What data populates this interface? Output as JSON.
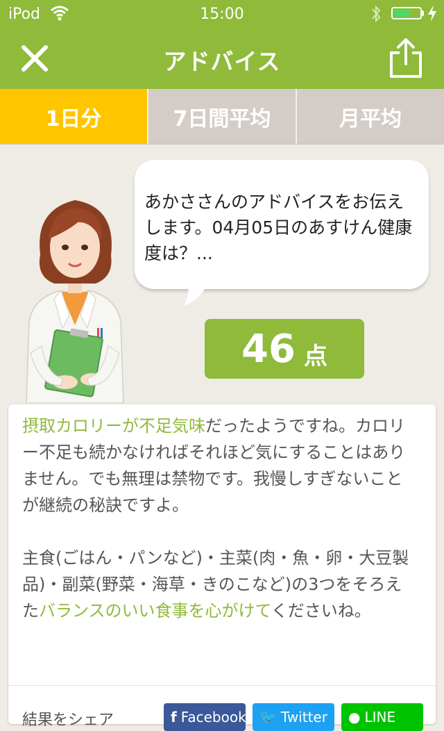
{
  "status_bar": {
    "carrier": "iPod",
    "time": "15:00",
    "battery_level": 0.65
  },
  "nav": {
    "title": "アドバイス",
    "close_icon": "close-icon",
    "share_icon": "share-icon"
  },
  "tabs": [
    {
      "label": "1日分",
      "active": true
    },
    {
      "label": "7日間平均",
      "active": false
    },
    {
      "label": "月平均",
      "active": false
    }
  ],
  "bubble": {
    "text": "あかささんのアドバイスをお伝えします。04月05日のあすけん健康度は？..."
  },
  "score": {
    "value": "46",
    "unit": "点"
  },
  "advice": {
    "p1_highlight": "摂取カロリーが不足気味",
    "p1_rest": "だったようですね。カロリー不足も続かなければそれほど気にすることはありません。でも無理は禁物です。我慢しすぎないことが継続の秘訣ですよ。",
    "p2_start": "主食(ごはん・パンなど)・主菜(肉・魚・卵・大豆製品)・副菜(野菜・海草・きのこなど)の3つをそろえた",
    "p2_highlight": "バランスのいい食事を心がけて",
    "p2_end": "くださいね。"
  },
  "share": {
    "label": "結果をシェア",
    "facebook": "Facebook",
    "twitter": "Twitter",
    "line": "LINE"
  },
  "colors": {
    "brand_green": "#8fba3a",
    "tab_active": "#ffc600",
    "tab_inactive": "#d4cdc7",
    "background": "#efece6"
  }
}
